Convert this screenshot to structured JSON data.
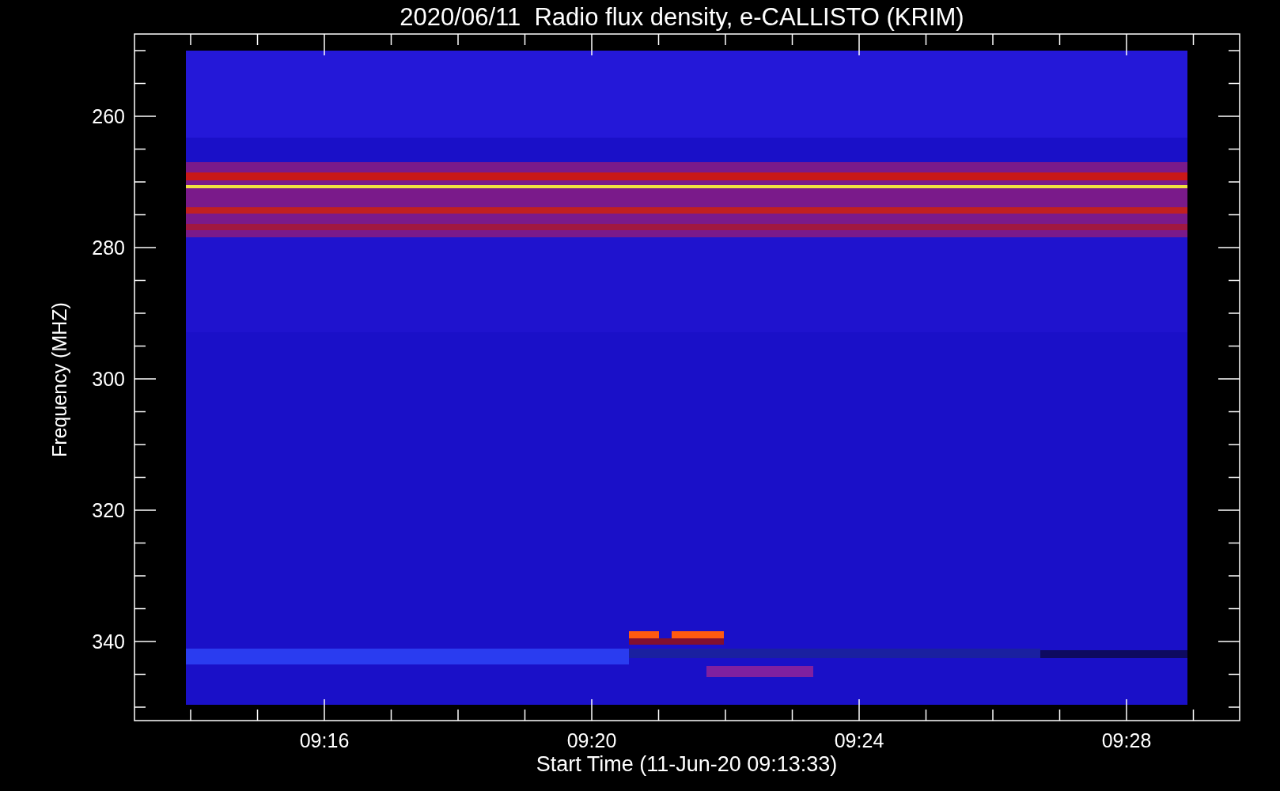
{
  "title": "2020/06/11  Radio flux density, e-CALLISTO (KRIM)",
  "y_axis": {
    "label": "Frequency (MHZ)",
    "ticks": [
      "260",
      "280",
      "300",
      "320",
      "340"
    ]
  },
  "x_axis": {
    "label": "Start Time (11-Jun-20 09:13:33)",
    "ticks": [
      "09:16",
      "09:20",
      "09:24",
      "09:28"
    ]
  }
}
